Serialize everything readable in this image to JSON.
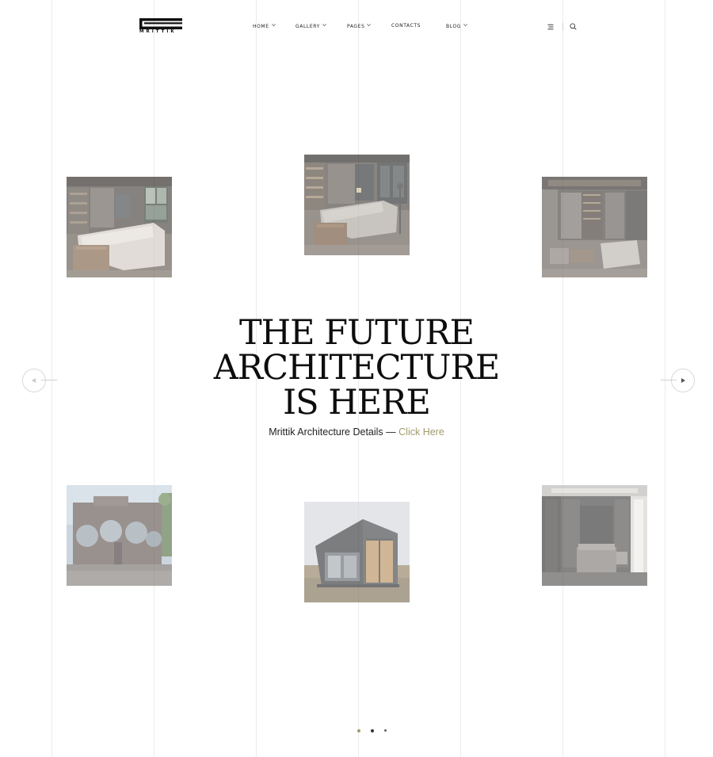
{
  "brand": {
    "name": "MRITTIK"
  },
  "nav": {
    "items": [
      {
        "label": "HOME",
        "has_dropdown": true
      },
      {
        "label": "GALLERY",
        "has_dropdown": true
      },
      {
        "label": "PAGES",
        "has_dropdown": true
      },
      {
        "label": "CONTACTS",
        "has_dropdown": false
      },
      {
        "label": "BLOG",
        "has_dropdown": true
      }
    ],
    "icons": [
      "menu-icon",
      "search-icon"
    ]
  },
  "hero": {
    "title_lines": [
      "THE FUTURE",
      "ARCHITECTURE",
      "IS HERE"
    ],
    "subtitle": "Mrittik Architecture Details —",
    "link": "Click Here"
  },
  "slider": {
    "prev_icon": "arrow-left-icon",
    "next_icon": "arrow-right-icon",
    "dots": 3,
    "active_dot": 1
  },
  "colors": {
    "accent": "#a29a6b",
    "text": "#111111",
    "gridline": "#ececec"
  }
}
